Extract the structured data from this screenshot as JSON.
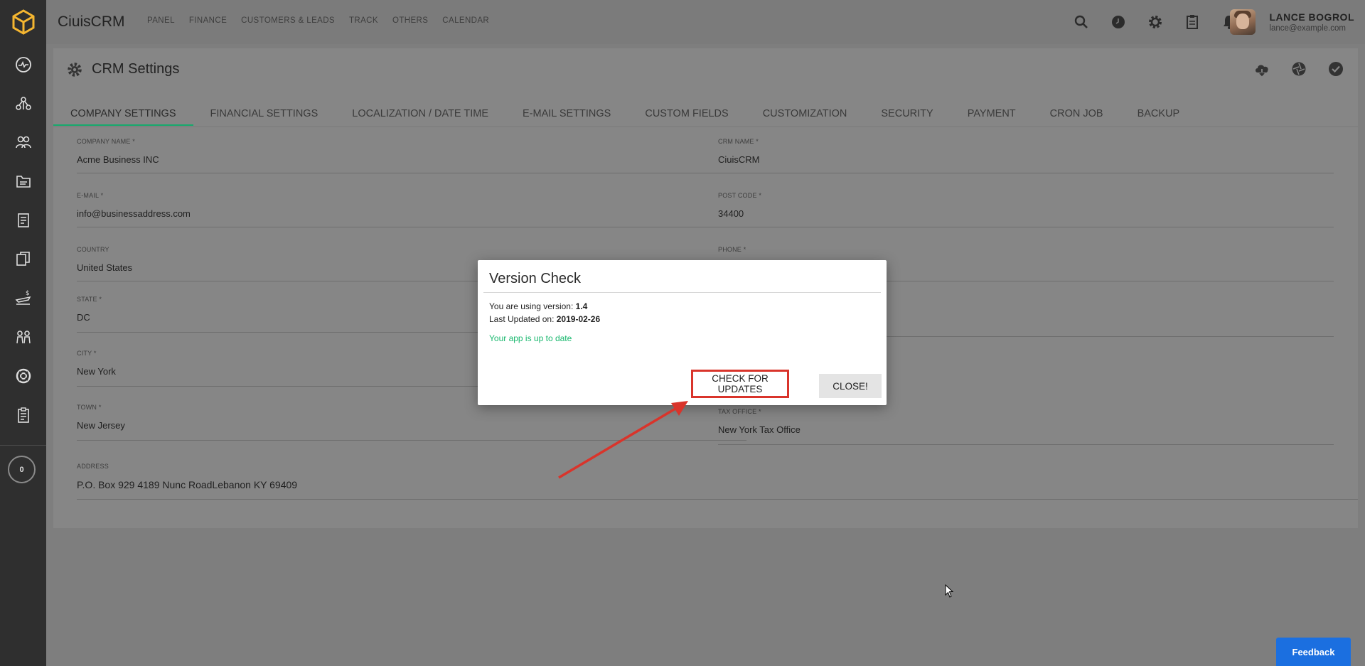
{
  "app": {
    "name": "CiuisCRM"
  },
  "topnav": [
    "PANEL",
    "FINANCE",
    "CUSTOMERS & LEADS",
    "TRACK",
    "OTHERS",
    "CALENDAR"
  ],
  "user": {
    "name": "LANCE BOGROL",
    "email": "lance@example.com"
  },
  "sidebar": {
    "timer_value": "0"
  },
  "page": {
    "title": "CRM Settings"
  },
  "tabs": [
    "COMPANY SETTINGS",
    "FINANCIAL SETTINGS",
    "LOCALIZATION / DATE TIME",
    "E-MAIL SETTINGS",
    "CUSTOM FIELDS",
    "CUSTOMIZATION",
    "SECURITY",
    "PAYMENT",
    "CRON JOB",
    "BACKUP"
  ],
  "form": {
    "company_name": {
      "label": "COMPANY NAME *",
      "value": "Acme Business INC"
    },
    "crm_name": {
      "label": "CRM NAME *",
      "value": "CiuisCRM"
    },
    "email": {
      "label": "E-MAIL *",
      "value": "info@businessaddress.com"
    },
    "post_code": {
      "label": "POST CODE *",
      "value": "34400"
    },
    "country": {
      "label": "COUNTRY",
      "value": "United States"
    },
    "phone": {
      "label": "PHONE *",
      "value": ""
    },
    "state": {
      "label": "STATE *",
      "value": "DC"
    },
    "city": {
      "label": "CITY *",
      "value": "New York"
    },
    "town": {
      "label": "TOWN *",
      "value": "New Jersey"
    },
    "tax_office": {
      "label": "TAX OFFICE *",
      "value": "New York Tax Office"
    },
    "address": {
      "label": "ADDRESS",
      "value": "P.O. Box 929 4189 Nunc RoadLebanon KY 69409"
    }
  },
  "modal": {
    "title": "Version Check",
    "version_prefix": "You are using version:",
    "version": "1.4",
    "updated_prefix": "Last Updated on:",
    "updated": "2019-02-26",
    "status": "Your app is up to date",
    "check_label": "CHECK FOR UPDATES",
    "close_label": "CLOSE!"
  },
  "feedback_label": "Feedback",
  "colors": {
    "accent_green": "#17a96c",
    "status_green": "#19b86e",
    "highlight_red": "#d9342b",
    "feedback_blue": "#1b6fe0",
    "logo_yellow": "#f5b630"
  }
}
